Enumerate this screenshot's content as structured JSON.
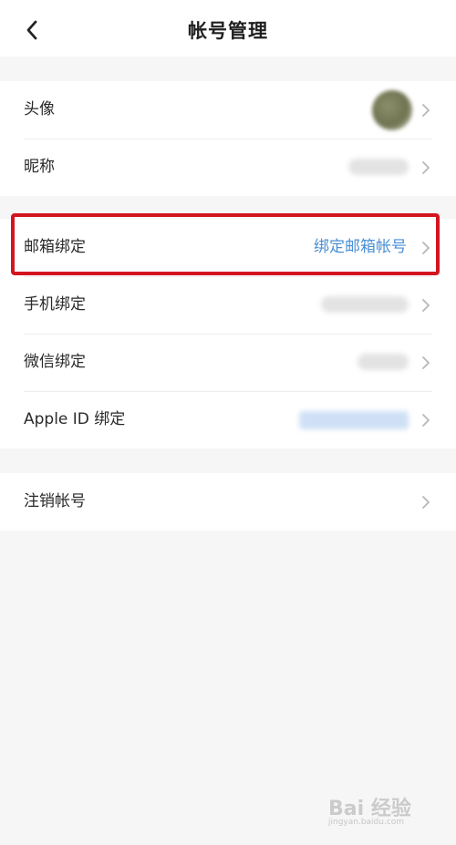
{
  "header": {
    "title": "帐号管理",
    "back_icon": "chevron-left-icon"
  },
  "profile": {
    "avatar_label": "头像",
    "nickname_label": "昵称"
  },
  "bindings": {
    "email_label": "邮箱绑定",
    "email_value": "绑定邮箱帐号",
    "phone_label": "手机绑定",
    "wechat_label": "微信绑定",
    "apple_label": "Apple ID 绑定"
  },
  "account": {
    "cancel_label": "注销帐号"
  },
  "watermark": {
    "text": "Bai 经验",
    "subtext": "jingyan.baidu.com"
  },
  "colors": {
    "accent_link": "#4a8fd4",
    "highlight_border": "#d2151f",
    "background": "#f6f6f6"
  }
}
